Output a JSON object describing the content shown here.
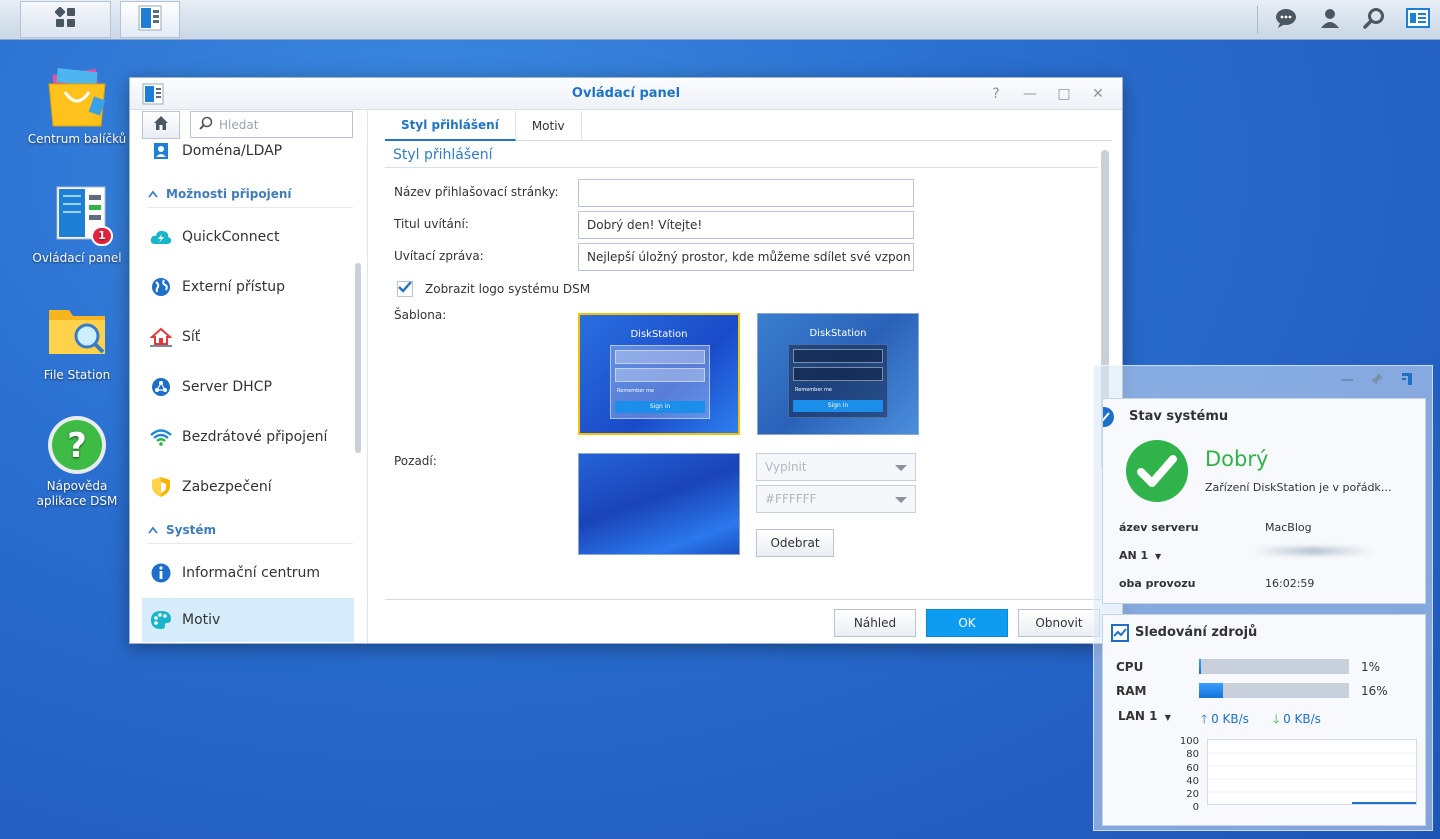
{
  "desktop": {
    "icons": [
      {
        "label": "Centrum balíčků"
      },
      {
        "label": "Ovládací panel",
        "badge": "1"
      },
      {
        "label": "File Station"
      },
      {
        "label": "Nápověda aplikace DSM"
      }
    ]
  },
  "window": {
    "title": "Ovládací panel",
    "controls": [
      "?",
      "—",
      "□",
      "✕"
    ],
    "search_placeholder": "Hledat",
    "sidebar": {
      "items_top": [
        {
          "label": "Doména/LDAP"
        }
      ],
      "group1": "Možnosti připojení",
      "group1_items": [
        {
          "label": "QuickConnect"
        },
        {
          "label": "Externí přístup"
        },
        {
          "label": "Síť"
        },
        {
          "label": "Server DHCP"
        },
        {
          "label": "Bezdrátové připojení"
        },
        {
          "label": "Zabezpečení"
        }
      ],
      "group2": "Systém",
      "group2_items": [
        {
          "label": "Informační centrum"
        },
        {
          "label": "Motiv"
        }
      ]
    },
    "tabs": [
      {
        "label": "Styl přihlášení"
      },
      {
        "label": "Motiv"
      }
    ],
    "section_title": "Styl přihlášení",
    "form": {
      "page_name_label": "Název přihlašovací stránky:",
      "page_name_value": "",
      "welcome_title_label": "Titul uvítání:",
      "welcome_title_value": "Dobrý den! Vítejte!",
      "welcome_msg_label": "Uvítací zpráva:",
      "welcome_msg_value": "Nejlepší úložný prostor, kde můžeme sdílet své vzpon",
      "show_logo_label": "Zobrazit logo systému DSM",
      "template_label": "Šablona:",
      "background_label": "Pozadí:",
      "fill_select": "Vyplnit",
      "color_select": "#FFFFFF",
      "remove_button": "Odebrat"
    },
    "template_preview": {
      "brand": "DiskStation",
      "remember": "Remember me",
      "signin": "Sign in"
    },
    "footer": {
      "preview": "Náhled",
      "ok": "OK",
      "reset": "Obnovit"
    }
  },
  "widgets": {
    "system_status": {
      "title": "Stav systému",
      "status": "Dobrý",
      "status_desc": "Zařízení DiskStation je v pořádk…",
      "server_name_label": "ázev serveru",
      "server_name": "MacBlog",
      "lan_label": "AN 1",
      "uptime_label": "oba provozu",
      "uptime": "16:02:59"
    },
    "resource_monitor": {
      "title": "Sledování zdrojů",
      "cpu_label": "CPU",
      "cpu_value": "1%",
      "ram_label": "RAM",
      "ram_value": "16%",
      "lan_label": "LAN 1",
      "up": "0 KB/s",
      "down": "0 KB/s",
      "y_ticks": [
        "100",
        "80",
        "60",
        "40",
        "20",
        "0"
      ]
    }
  },
  "colors": {
    "accent": "#1f74c4",
    "ok_button": "#0e9cf0",
    "status_green": "#2fb34a",
    "active_nav": "#d7ecfb"
  }
}
